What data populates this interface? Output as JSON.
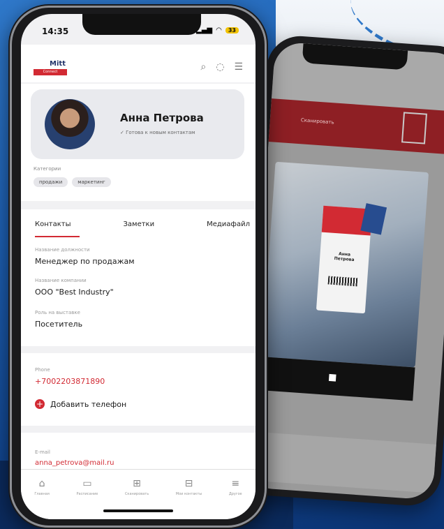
{
  "status": {
    "time": "14:35",
    "battery": "33"
  },
  "brand": {
    "logo_text": "Mitt",
    "logo_sub": "Connect"
  },
  "profile": {
    "name": "Анна Петрова",
    "status_text": "✓ Готова к новым контактам",
    "categories_label": "Категории",
    "chips": [
      "продажи",
      "маркетинг"
    ]
  },
  "tabs": [
    "Контакты",
    "Заметки",
    "Медиафайл"
  ],
  "fields": [
    {
      "label": "Название должности",
      "value": "Менеджер по продажам"
    },
    {
      "label": "Название компании",
      "value": "ООО \"Best Industry\""
    },
    {
      "label": "Роль на выставке",
      "value": "Посетитель"
    }
  ],
  "phone": {
    "label": "Phone",
    "value": "+7002203871890",
    "add_label": "Добавить телефон"
  },
  "email": {
    "label": "E-mail",
    "value": "anna_petrova@mail.ru"
  },
  "nav": [
    {
      "icon": "home-icon",
      "label": "Главная"
    },
    {
      "icon": "laptop-icon",
      "label": "Расписание"
    },
    {
      "icon": "qr-scan-icon",
      "label": "Сканировать"
    },
    {
      "icon": "contacts-icon",
      "label": "Мои контакты"
    },
    {
      "icon": "menu-icon",
      "label": "Другое"
    }
  ],
  "back_phone": {
    "banner_text": "Сканировать",
    "badge_name": "Анна Петрова"
  },
  "colors": {
    "accent": "#d22a33",
    "brand_blue": "#23356b"
  }
}
